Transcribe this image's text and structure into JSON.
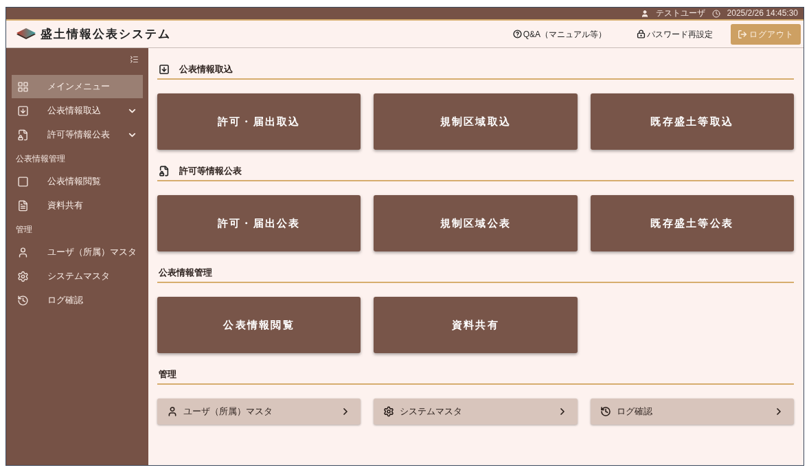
{
  "top_bar": {
    "user": "テストユーザ",
    "datetime": "2025/2/26 14:45:30"
  },
  "header": {
    "title": "盛土情報公表システム",
    "links": [
      "Q&A（マニュアル等）",
      "パスワード再設定"
    ],
    "logout": "ログアウト"
  },
  "sidebar": {
    "items": [
      {
        "kind": "item",
        "label": "メインメニュー",
        "selected": true
      },
      {
        "kind": "group",
        "label": "公表情報取込",
        "selected": false,
        "expanded": false
      },
      {
        "kind": "group",
        "label": "許可等情報公表",
        "selected": false,
        "expanded": false
      },
      {
        "kind": "heading",
        "label": "公表情報管理"
      },
      {
        "kind": "item",
        "label": "公表情報閲覧",
        "selected": false
      },
      {
        "kind": "item",
        "label": "資料共有",
        "selected": false
      },
      {
        "kind": "heading",
        "label": "管理"
      },
      {
        "kind": "item",
        "label": "ユーザ（所属）マスタ",
        "selected": false
      },
      {
        "kind": "item",
        "label": "システムマスタ",
        "selected": false
      },
      {
        "kind": "item",
        "label": "ログ確認",
        "selected": false
      }
    ]
  },
  "sections": [
    {
      "title": "公表情報取込",
      "kind": "big",
      "tiles": [
        "許可・届出取込",
        "規制区域取込",
        "既存盛土等取込"
      ]
    },
    {
      "title": "許可等情報公表",
      "kind": "big",
      "tiles": [
        "許可・届出公表",
        "規制区域公表",
        "既存盛土等公表"
      ]
    },
    {
      "title": "公表情報管理",
      "kind": "big",
      "tiles": [
        "公表情報閲覧",
        "資料共有"
      ]
    },
    {
      "title": "管理",
      "kind": "small",
      "tiles": [
        "ユーザ（所属）マスタ",
        "システムマスタ",
        "ログ確認"
      ]
    }
  ]
}
